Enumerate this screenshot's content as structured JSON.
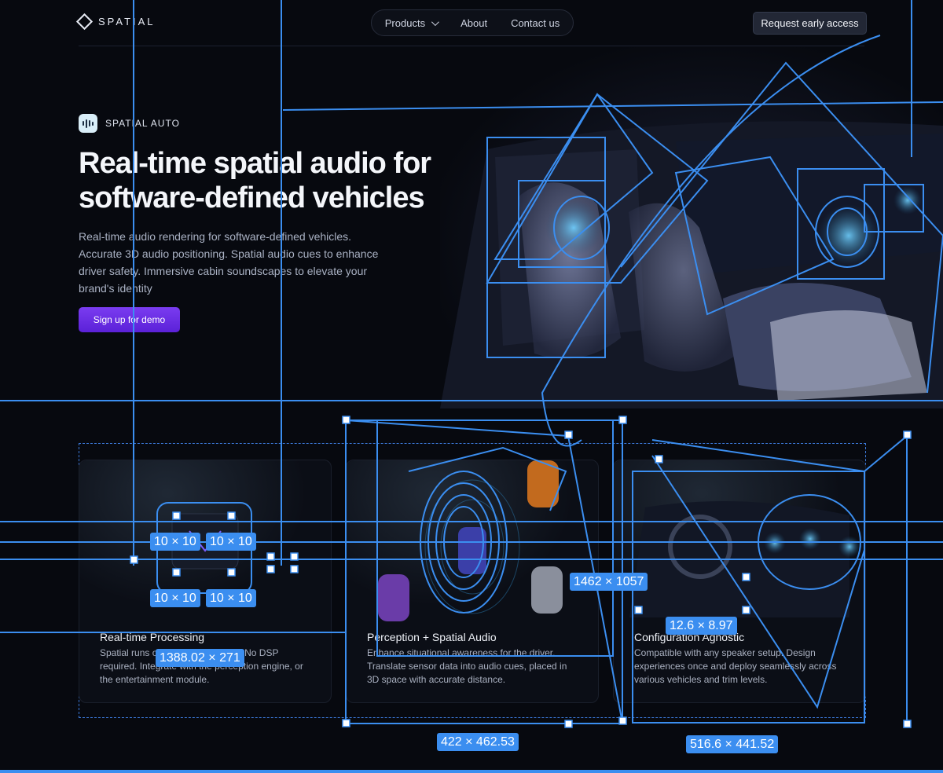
{
  "brand": {
    "name": "SPATIAL",
    "icon": "diamond-logo-icon"
  },
  "nav": {
    "products": "Products",
    "about": "About",
    "contact": "Contact us",
    "cta": "Request early access"
  },
  "hero": {
    "badge": "SPATIAL AUTO",
    "title": "Real-time spatial audio for software-defined vehicles",
    "description": "Real-time audio rendering for software-defined vehicles. Accurate 3D audio positioning. Spatial audio cues to enhance driver safety. Immersive cabin soundscapes to elevate your brand's identity",
    "button": "Sign up for demo"
  },
  "cards": [
    {
      "title": "Real-time Processing",
      "description": "Spatial runs on existing hardware. No DSP required. Integrate with the perception engine, or the entertainment module."
    },
    {
      "title": "Perception + Spatial Audio",
      "description": "Enhance situational awareness for the driver. Translate sensor data into audio cues, placed in 3D space with accurate distance."
    },
    {
      "title": "Configuration Agnostic",
      "description": "Compatible with any speaker setup. Design experiences once and deploy seamlessly across various vehicles and trim levels."
    }
  ],
  "measurements": {
    "chip_a": "10 × 10",
    "chip_b": "10 × 10",
    "chip_c": "10 × 10",
    "chip_d": "10 × 10",
    "chip_e": "1388.02 × 271",
    "chip_f": "1462 × 1057",
    "chip_g": "12.6 × 8.97",
    "chip_h": "422 × 462.53",
    "chip_i": "516.6 × 441.52"
  },
  "colors": {
    "accent": "#3b8ef0",
    "cta_purple": "#6a2ee6",
    "background": "#07090f"
  }
}
